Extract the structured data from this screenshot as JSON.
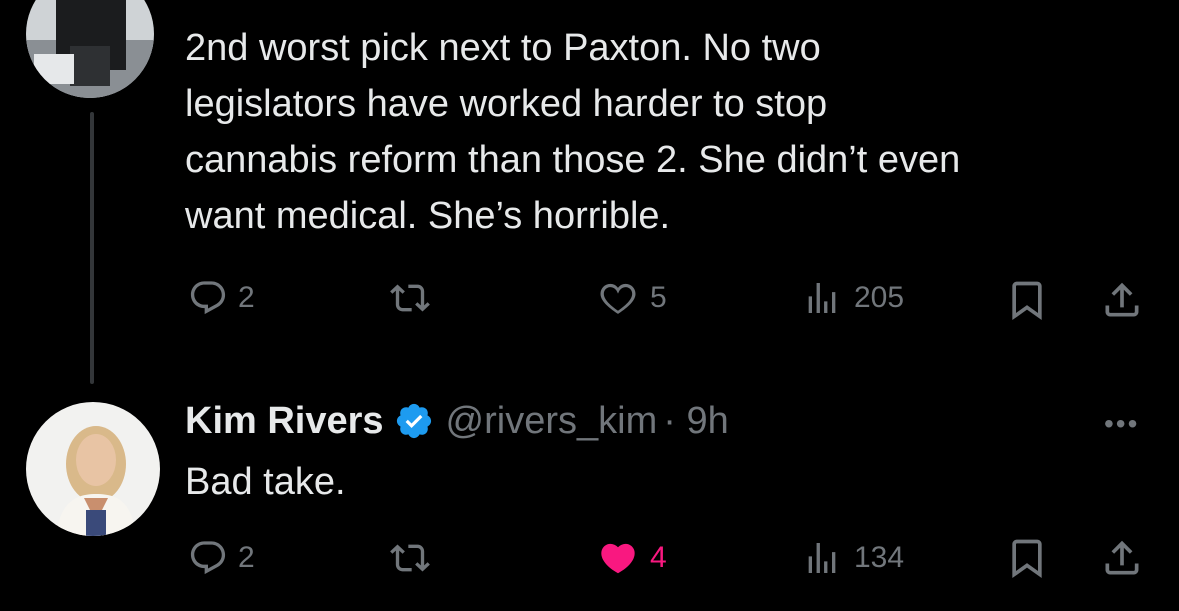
{
  "tweet1": {
    "text": "2nd worst pick next to Paxton. No two\nlegislators have worked harder to stop\ncannabis reform than those 2.  She didn’t even\nwant medical. She’s horrible.",
    "replies": "2",
    "likes": "5",
    "views": "205"
  },
  "tweet2": {
    "name": "Kim Rivers",
    "handle": "@rivers_kim",
    "time": "· 9h",
    "text": "Bad take.",
    "replies": "2",
    "likes": "4",
    "views": "134",
    "more": "•••"
  },
  "colors": {
    "background": "#000000",
    "text": "#e7e9ea",
    "muted": "#71767b",
    "verified": "#1d9bf0",
    "liked": "#f91880"
  },
  "icons": [
    "reply-icon",
    "retweet-icon",
    "like-icon",
    "views-icon",
    "bookmark-icon",
    "share-icon",
    "verified-badge-icon",
    "more-icon"
  ]
}
